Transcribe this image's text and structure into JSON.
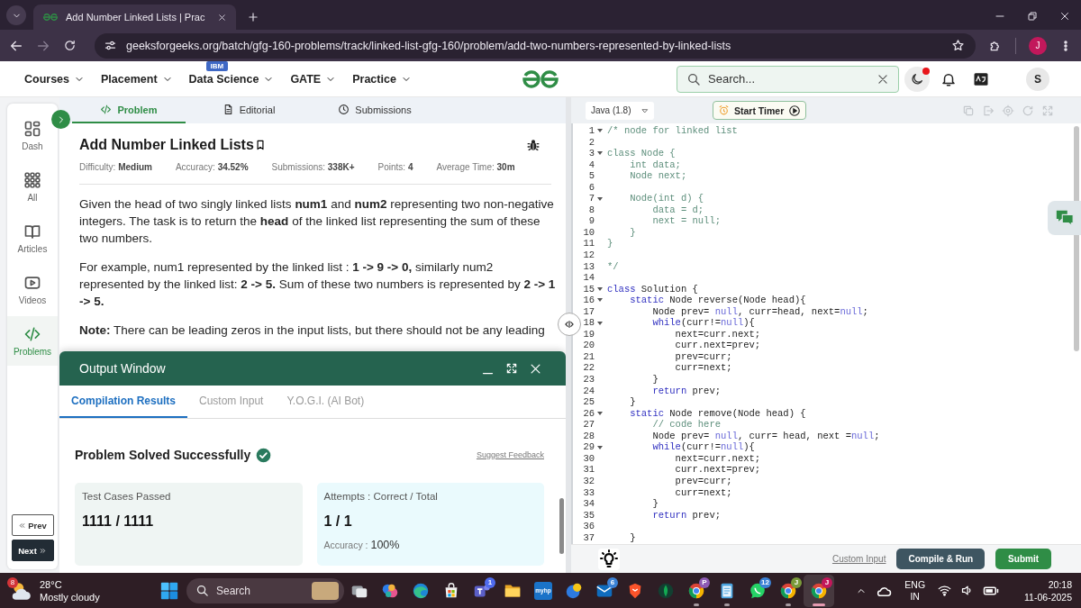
{
  "browser": {
    "tab_title": "Add Number Linked Lists | Prac",
    "url": "geeksforgeeks.org/batch/gfg-160-problems/track/linked-list-gfg-160/problem/add-two-numbers-represented-by-linked-lists",
    "profile": "J"
  },
  "site_nav": {
    "items": [
      {
        "label": "Courses"
      },
      {
        "label": "Placement"
      },
      {
        "label": "Data Science",
        "badge": "IBM"
      },
      {
        "label": "GATE"
      },
      {
        "label": "Practice"
      }
    ],
    "search": {
      "placeholder": "Search..."
    },
    "theme_toggle": {
      "alert": true
    },
    "avatar": "S"
  },
  "sidebar": {
    "items": [
      {
        "label": "Dash",
        "kind": "dash",
        "selected": false
      },
      {
        "label": "All",
        "kind": "grid",
        "selected": false
      },
      {
        "label": "Articles",
        "kind": "book",
        "selected": false
      },
      {
        "label": "Videos",
        "kind": "video",
        "selected": false
      },
      {
        "label": "Problems",
        "kind": "code",
        "selected": true
      }
    ],
    "prev": "Prev",
    "next": "Next"
  },
  "problem": {
    "tabs": [
      {
        "label": "Problem",
        "kind": "code",
        "selected": true
      },
      {
        "label": "Editorial",
        "kind": "document",
        "selected": false
      },
      {
        "label": "Submissions",
        "kind": "clock",
        "selected": false
      }
    ],
    "title": "Add Number Linked Lists",
    "meta": [
      {
        "label": "Difficulty:",
        "value": "Medium"
      },
      {
        "label": "Accuracy:",
        "value": "34.52%"
      },
      {
        "label": "Submissions:",
        "value": "338K+"
      },
      {
        "label": "Points:",
        "value": "4"
      },
      {
        "label": "Average Time:",
        "value": "30m"
      }
    ],
    "paragraphs": [
      "Given the head of two singly linked lists **num1** and **num2** representing two non-negative integers. The task is to return the **head** of the linked list representing the sum of these two numbers.",
      "For example, num1 represented by the linked list : **1 -> 9 -> 0,** similarly num2 represented by the linked list: **2 -> 5.** Sum of these two numbers is represented by **2 -> 1 -> 5.**",
      "**Note:** There can be leading zeros in the input lists, but there should not be any leading"
    ]
  },
  "output": {
    "title": "Output Window",
    "tabs": [
      {
        "label": "Compilation Results",
        "selected": true
      },
      {
        "label": "Custom Input",
        "selected": false
      },
      {
        "label": "Y.O.G.I. (AI Bot)",
        "selected": false
      }
    ],
    "status": "Problem Solved Successfully",
    "feedback": "Suggest Feedback",
    "cards": [
      {
        "label": "Test Cases Passed",
        "value": "1111 / 1111"
      },
      {
        "label": "Attempts : Correct / Total",
        "value": "1 / 1",
        "accuracy_label": "Accuracy :",
        "accuracy_value": "100%"
      }
    ]
  },
  "editor": {
    "language": "Java (1.8)",
    "timer": "Start Timer",
    "lines": [
      {
        "number": "1",
        "fold": true,
        "tokens": [
          {
            "kind": "comment",
            "text": "/* node for linked list"
          }
        ]
      },
      {
        "number": "2",
        "fold": false
      },
      {
        "number": "3",
        "fold": true,
        "tokens": [
          {
            "kind": "comment",
            "text": "class Node {"
          }
        ]
      },
      {
        "number": "4",
        "fold": false,
        "tokens": [
          {
            "kind": "comment",
            "text": "    int data;"
          }
        ]
      },
      {
        "number": "5",
        "fold": false,
        "tokens": [
          {
            "kind": "comment",
            "text": "    Node next;"
          }
        ]
      },
      {
        "number": "6",
        "fold": false
      },
      {
        "number": "7",
        "fold": true,
        "tokens": [
          {
            "kind": "comment",
            "text": "    Node(int d) {"
          }
        ]
      },
      {
        "number": "8",
        "fold": false,
        "tokens": [
          {
            "kind": "comment",
            "text": "        data = d;"
          }
        ]
      },
      {
        "number": "9",
        "fold": false,
        "tokens": [
          {
            "kind": "comment",
            "text": "        next = null;"
          }
        ]
      },
      {
        "number": "10",
        "fold": false,
        "tokens": [
          {
            "kind": "comment",
            "text": "    }"
          }
        ]
      },
      {
        "number": "11",
        "fold": false,
        "tokens": [
          {
            "kind": "comment",
            "text": "}"
          }
        ]
      },
      {
        "number": "12",
        "fold": false
      },
      {
        "number": "13",
        "fold": false,
        "tokens": [
          {
            "kind": "comment",
            "text": "*/"
          }
        ]
      },
      {
        "number": "14",
        "fold": false
      },
      {
        "number": "15",
        "fold": true,
        "tokens": [
          {
            "kind": "keyword",
            "text": "class"
          },
          {
            "kind": "text",
            "text": " Solution {"
          }
        ]
      },
      {
        "number": "16",
        "fold": true,
        "tokens": [
          {
            "kind": "keyword",
            "text": "    static"
          },
          {
            "kind": "text",
            "text": " Node reverse(Node head){"
          }
        ]
      },
      {
        "number": "17",
        "fold": false,
        "tokens": [
          {
            "kind": "text",
            "text": "        Node prev= "
          },
          {
            "kind": "literal",
            "text": "null"
          },
          {
            "kind": "text",
            "text": ", curr=head, next="
          },
          {
            "kind": "literal",
            "text": "null"
          },
          {
            "kind": "text",
            "text": ";"
          }
        ]
      },
      {
        "number": "18",
        "fold": true,
        "tokens": [
          {
            "kind": "keyword",
            "text": "        while"
          },
          {
            "kind": "text",
            "text": "(curr!="
          },
          {
            "kind": "literal",
            "text": "null"
          },
          {
            "kind": "text",
            "text": "){"
          }
        ]
      },
      {
        "number": "19",
        "fold": false,
        "tokens": [
          {
            "kind": "text",
            "text": "            next=curr.next;"
          }
        ]
      },
      {
        "number": "20",
        "fold": false,
        "tokens": [
          {
            "kind": "text",
            "text": "            curr.next=prev;"
          }
        ]
      },
      {
        "number": "21",
        "fold": false,
        "tokens": [
          {
            "kind": "text",
            "text": "            prev=curr;"
          }
        ]
      },
      {
        "number": "22",
        "fold": false,
        "tokens": [
          {
            "kind": "text",
            "text": "            curr=next;"
          }
        ]
      },
      {
        "number": "23",
        "fold": false,
        "tokens": [
          {
            "kind": "text",
            "text": "        }"
          }
        ]
      },
      {
        "number": "24",
        "fold": false,
        "tokens": [
          {
            "kind": "keyword",
            "text": "        return"
          },
          {
            "kind": "text",
            "text": " prev;"
          }
        ]
      },
      {
        "number": "25",
        "fold": false,
        "tokens": [
          {
            "kind": "text",
            "text": "    }"
          }
        ]
      },
      {
        "number": "26",
        "fold": true,
        "tokens": [
          {
            "kind": "keyword",
            "text": "    static"
          },
          {
            "kind": "text",
            "text": " Node remove(Node head) {"
          }
        ]
      },
      {
        "number": "27",
        "fold": false,
        "tokens": [
          {
            "kind": "comment",
            "text": "        // code here"
          }
        ]
      },
      {
        "number": "28",
        "fold": false,
        "tokens": [
          {
            "kind": "text",
            "text": "        Node prev= "
          },
          {
            "kind": "literal",
            "text": "null"
          },
          {
            "kind": "text",
            "text": ", curr= head, next ="
          },
          {
            "kind": "literal",
            "text": "null"
          },
          {
            "kind": "text",
            "text": ";"
          }
        ]
      },
      {
        "number": "29",
        "fold": true,
        "tokens": [
          {
            "kind": "keyword",
            "text": "        while"
          },
          {
            "kind": "text",
            "text": "(curr!="
          },
          {
            "kind": "literal",
            "text": "null"
          },
          {
            "kind": "text",
            "text": "){"
          }
        ]
      },
      {
        "number": "30",
        "fold": false,
        "tokens": [
          {
            "kind": "text",
            "text": "            next=curr.next;"
          }
        ]
      },
      {
        "number": "31",
        "fold": false,
        "tokens": [
          {
            "kind": "text",
            "text": "            curr.next=prev;"
          }
        ]
      },
      {
        "number": "32",
        "fold": false,
        "tokens": [
          {
            "kind": "text",
            "text": "            prev=curr;"
          }
        ]
      },
      {
        "number": "33",
        "fold": false,
        "tokens": [
          {
            "kind": "text",
            "text": "            curr=next;"
          }
        ]
      },
      {
        "number": "34",
        "fold": false,
        "tokens": [
          {
            "kind": "text",
            "text": "        }"
          }
        ]
      },
      {
        "number": "35",
        "fold": false,
        "tokens": [
          {
            "kind": "keyword",
            "text": "        return"
          },
          {
            "kind": "text",
            "text": " prev;"
          }
        ]
      },
      {
        "number": "36",
        "fold": false
      },
      {
        "number": "37",
        "fold": false,
        "tokens": [
          {
            "kind": "text",
            "text": "    }"
          }
        ]
      }
    ],
    "custom_input": "Custom Input",
    "buttons": [
      "Compile & Run",
      "Submit"
    ]
  },
  "taskbar": {
    "weather": {
      "badge": "8",
      "temperature": "28°C",
      "condition": "Mostly cloudy"
    },
    "search": {
      "placeholder": "Search"
    },
    "apps": [
      {
        "kind": "squares",
        "running": false,
        "selected": false
      },
      {
        "kind": "swirl",
        "running": false,
        "selected": false
      },
      {
        "kind": "wave",
        "running": false,
        "selected": false
      },
      {
        "kind": "bag",
        "running": false,
        "selected": false
      },
      {
        "kind": "people",
        "badge": "1",
        "color": "#4f6bed",
        "running": false,
        "selected": false
      },
      {
        "kind": "folder",
        "running": false,
        "selected": false
      },
      {
        "kind": "tile",
        "label": "myhp",
        "running": false,
        "selected": false
      },
      {
        "kind": "orb",
        "running": false,
        "selected": false
      },
      {
        "kind": "mail",
        "badge": "6",
        "color": "#3b82d6",
        "running": false,
        "selected": false
      },
      {
        "kind": "shield",
        "running": false,
        "selected": false
      },
      {
        "kind": "leaf",
        "running": false,
        "selected": false
      },
      {
        "kind": "ring",
        "badge": "P",
        "color": "#8e5bb5",
        "running": true,
        "selected": false
      },
      {
        "kind": "notepad",
        "running": true,
        "selected": false
      },
      {
        "kind": "chat",
        "badge": "12",
        "color": "#3b82d6",
        "running": false,
        "selected": false
      },
      {
        "kind": "ring",
        "badge": "J",
        "color": "#7a9a3a",
        "running": true,
        "selected": false
      },
      {
        "kind": "ring",
        "badge": "J",
        "color": "#c2185b",
        "running": true,
        "selected": true
      }
    ],
    "language": "ENG",
    "region": "IN",
    "time": "20:18",
    "date": "11-06-2025"
  }
}
